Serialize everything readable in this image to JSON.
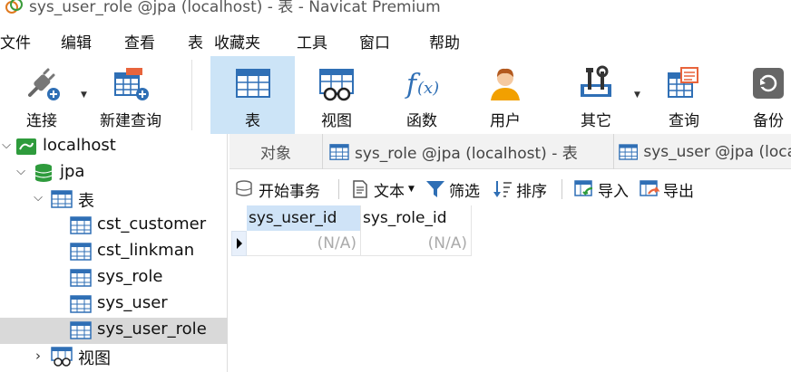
{
  "window": {
    "title": "sys_user_role @jpa (localhost) - 表 - Navicat Premium"
  },
  "menu": {
    "items": [
      "文件",
      "编辑",
      "查看",
      "表",
      "收藏夹",
      "工具",
      "窗口",
      "帮助"
    ]
  },
  "toolbar": {
    "buttons": [
      {
        "label": "连接",
        "icon": "plug-add-icon"
      },
      {
        "label": "新建查询",
        "icon": "new-query-icon"
      },
      {
        "label": "表",
        "icon": "table-icon"
      },
      {
        "label": "视图",
        "icon": "view-icon"
      },
      {
        "label": "函数",
        "icon": "function-icon"
      },
      {
        "label": "用户",
        "icon": "user-icon"
      },
      {
        "label": "其它",
        "icon": "tools-icon"
      },
      {
        "label": "查询",
        "icon": "query-icon"
      },
      {
        "label": "备份",
        "icon": "backup-icon"
      }
    ],
    "active_label": "表"
  },
  "tree": {
    "connection": "localhost",
    "database": "jpa",
    "tables_folder": "表",
    "tables": [
      "cst_customer",
      "cst_linkman",
      "sys_role",
      "sys_user",
      "sys_user_role"
    ],
    "selected_table": "sys_user_role",
    "views_folder": "视图"
  },
  "tabs": {
    "objects_label": "对象",
    "open": [
      {
        "label": "sys_role @jpa (localhost) - 表"
      },
      {
        "label": "sys_user @jpa (loca"
      }
    ]
  },
  "subtoolbar": {
    "begin_transaction": "开始事务",
    "text": "文本",
    "filter": "筛选",
    "sort": "排序",
    "import": "导入",
    "export": "导出"
  },
  "grid": {
    "columns": [
      "sys_user_id",
      "sys_role_id"
    ],
    "rows": [
      [
        "(N/A)",
        "(N/A)"
      ]
    ]
  },
  "colors": {
    "active_toolbar_bg": "#cce4f7",
    "selected_tree_bg": "#d9d9d9",
    "table_icon_blue": "#2f6fb5",
    "db_icon_green": "#2e9b3c"
  }
}
